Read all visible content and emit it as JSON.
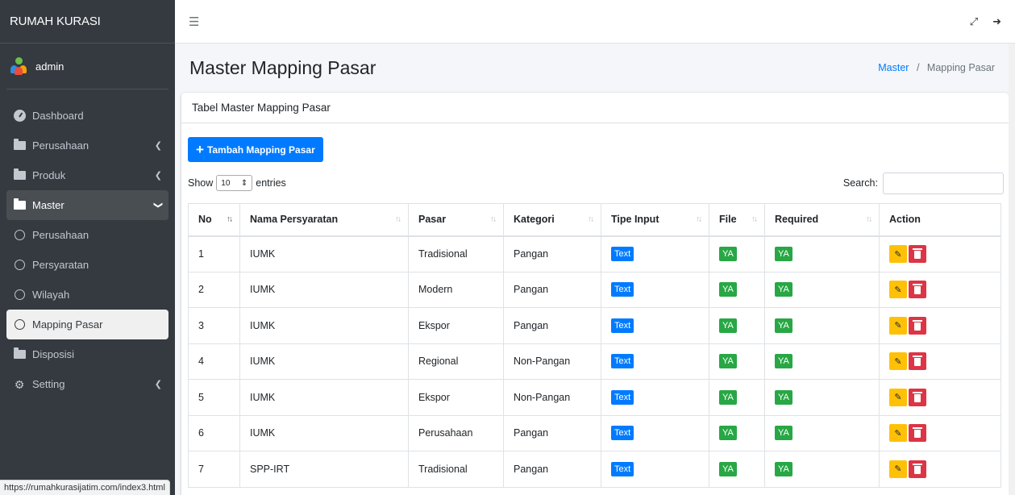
{
  "app": {
    "brand": "RUMAH KURASI"
  },
  "user": {
    "name": "admin"
  },
  "sidebar": {
    "items": [
      {
        "label": "Dashboard"
      },
      {
        "label": "Perusahaan"
      },
      {
        "label": "Produk"
      },
      {
        "label": "Master"
      },
      {
        "label": "Perusahaan"
      },
      {
        "label": "Persyaratan"
      },
      {
        "label": "Wilayah"
      },
      {
        "label": "Mapping Pasar"
      },
      {
        "label": "Disposisi"
      },
      {
        "label": "Setting"
      }
    ]
  },
  "header": {
    "title": "Master Mapping Pasar"
  },
  "breadcrumb": {
    "root": "Master",
    "current": "Mapping Pasar"
  },
  "card": {
    "title": "Tabel Master Mapping Pasar",
    "add_label": "Tambah Mapping Pasar"
  },
  "datatable": {
    "show": "Show",
    "entries": "entries",
    "length": "10",
    "search_label": "Search:"
  },
  "table": {
    "columns": [
      "No",
      "Nama Persyaratan",
      "Pasar",
      "Kategori",
      "Tipe Input",
      "File",
      "Required",
      "Action"
    ],
    "rows": [
      {
        "no": "1",
        "nama": "IUMK",
        "pasar": "Tradisional",
        "kategori": "Pangan",
        "tipe": "Text",
        "file": "YA",
        "required": "YA"
      },
      {
        "no": "2",
        "nama": "IUMK",
        "pasar": "Modern",
        "kategori": "Pangan",
        "tipe": "Text",
        "file": "YA",
        "required": "YA"
      },
      {
        "no": "3",
        "nama": "IUMK",
        "pasar": "Ekspor",
        "kategori": "Pangan",
        "tipe": "Text",
        "file": "YA",
        "required": "YA"
      },
      {
        "no": "4",
        "nama": "IUMK",
        "pasar": "Regional",
        "kategori": "Non-Pangan",
        "tipe": "Text",
        "file": "YA",
        "required": "YA"
      },
      {
        "no": "5",
        "nama": "IUMK",
        "pasar": "Ekspor",
        "kategori": "Non-Pangan",
        "tipe": "Text",
        "file": "YA",
        "required": "YA"
      },
      {
        "no": "6",
        "nama": "IUMK",
        "pasar": "Perusahaan",
        "kategori": "Pangan",
        "tipe": "Text",
        "file": "YA",
        "required": "YA"
      },
      {
        "no": "7",
        "nama": "SPP-IRT",
        "pasar": "Tradisional",
        "kategori": "Pangan",
        "tipe": "Text",
        "file": "YA",
        "required": "YA"
      }
    ]
  },
  "statusbar": {
    "url": "https://rumahkurasijatim.com/index3.html"
  },
  "colors": {
    "primary": "#007bff",
    "success": "#28a745",
    "warning": "#ffc107",
    "danger": "#dc3545",
    "sidebar": "#343a40"
  },
  "icons": {
    "menu": "hamburger-icon",
    "fullscreen": "expand-icon",
    "logout": "sign-out-icon"
  }
}
